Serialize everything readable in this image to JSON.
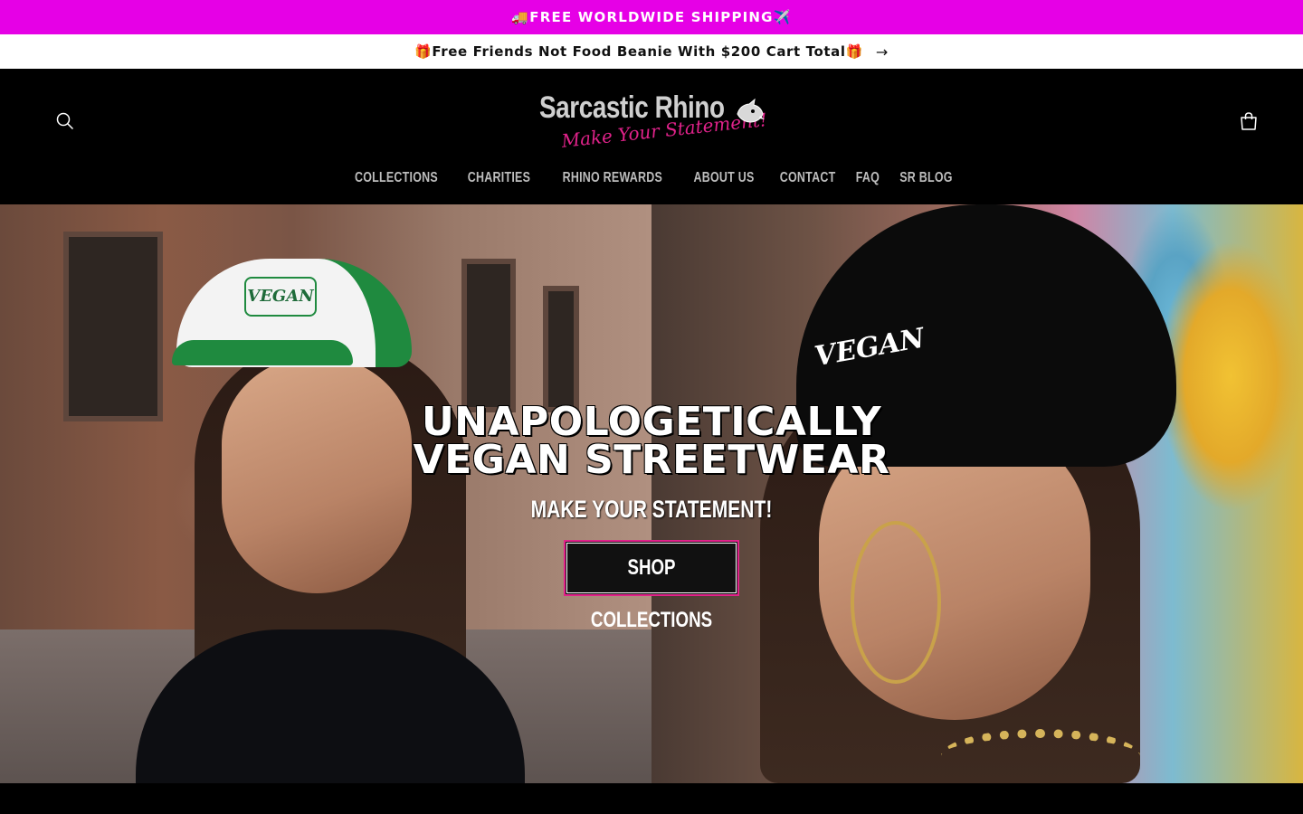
{
  "announcements": {
    "shipping": "🚚FREE WORLDWIDE SHIPPING✈️",
    "beanie": "🎁Free Friends Not Food Beanie With $200 Cart Total🎁",
    "beanie_arrow": "→"
  },
  "header": {
    "logo_main": "Sarcastic Rhino",
    "logo_tagline": "Make Your Statement!",
    "search_label": "Search",
    "cart_label": "Cart"
  },
  "nav": {
    "items": [
      "COLLECTIONS",
      "CHARITIES",
      "RHINO REWARDS",
      "ABOUT US",
      "CONTACT",
      "FAQ",
      "SR BLOG"
    ]
  },
  "hero": {
    "title_line1": "UNAPOLOGETICALLY",
    "title_line2": "VEGAN STREETWEAR",
    "subtitle": "MAKE YOUR STATEMENT!",
    "button_label": "SHOP COLLECTIONS",
    "left_hat_text": "VEGAN",
    "right_beanie_text": "VEGAN"
  },
  "colors": {
    "top_bar": "#e600e6",
    "accent_pink": "#e0228a",
    "header_bg": "#000000"
  }
}
